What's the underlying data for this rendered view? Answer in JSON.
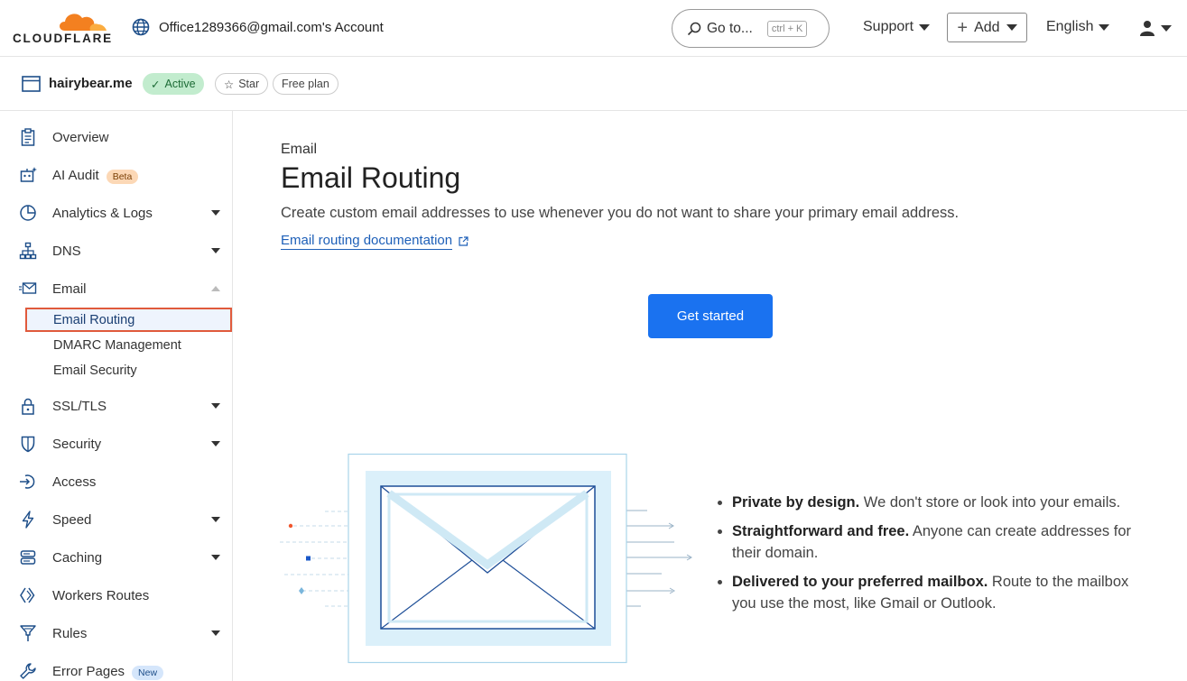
{
  "header": {
    "logo_text": "CLOUDFLARE",
    "account": "Office1289366@gmail.com's Account",
    "goto_label": "Go to...",
    "goto_shortcut": "ctrl + K",
    "support_label": "Support",
    "add_label": "Add",
    "language_label": "English",
    "user_icon": "user-icon"
  },
  "zone": {
    "name": "hairybear.me",
    "status": "Active",
    "star_label": "Star",
    "plan": "Free plan"
  },
  "sidebar": {
    "items": [
      {
        "label": "Overview",
        "icon": "clipboard-icon"
      },
      {
        "label": "AI Audit",
        "icon": "robot-icon",
        "badge": "Beta"
      },
      {
        "label": "Analytics & Logs",
        "icon": "pie-chart-icon"
      },
      {
        "label": "DNS",
        "icon": "network-icon"
      },
      {
        "label": "Email",
        "icon": "email-icon"
      },
      {
        "label": "SSL/TLS",
        "icon": "lock-icon"
      },
      {
        "label": "Security",
        "icon": "shield-icon"
      },
      {
        "label": "Access",
        "icon": "access-icon"
      },
      {
        "label": "Speed",
        "icon": "lightning-icon"
      },
      {
        "label": "Caching",
        "icon": "storage-icon"
      },
      {
        "label": "Workers Routes",
        "icon": "workers-icon"
      },
      {
        "label": "Rules",
        "icon": "rules-icon"
      },
      {
        "label": "Error Pages",
        "icon": "wrench-icon",
        "badge": "New"
      }
    ],
    "email_sub": [
      "Email Routing",
      "DMARC Management",
      "Email Security"
    ]
  },
  "main": {
    "breadcrumb": "Email",
    "title": "Email Routing",
    "description": "Create custom email addresses to use whenever you do not want to share your primary email address.",
    "doc_link": "Email routing documentation",
    "cta_label": "Get started",
    "features": [
      {
        "bold": "Private by design.",
        "text": " We don't store or look into your emails."
      },
      {
        "bold": "Straightforward and free.",
        "text": " Anyone can create addresses for their domain."
      },
      {
        "bold": "Delivered to your preferred mailbox.",
        "text": " Route to the mailbox you use the most, like Gmail or Outlook."
      }
    ]
  },
  "colors": {
    "accent": "#1a72f0",
    "logo_orange": "#f38020",
    "active_green": "#c2ecce",
    "highlight_border": "#e05a3c"
  }
}
